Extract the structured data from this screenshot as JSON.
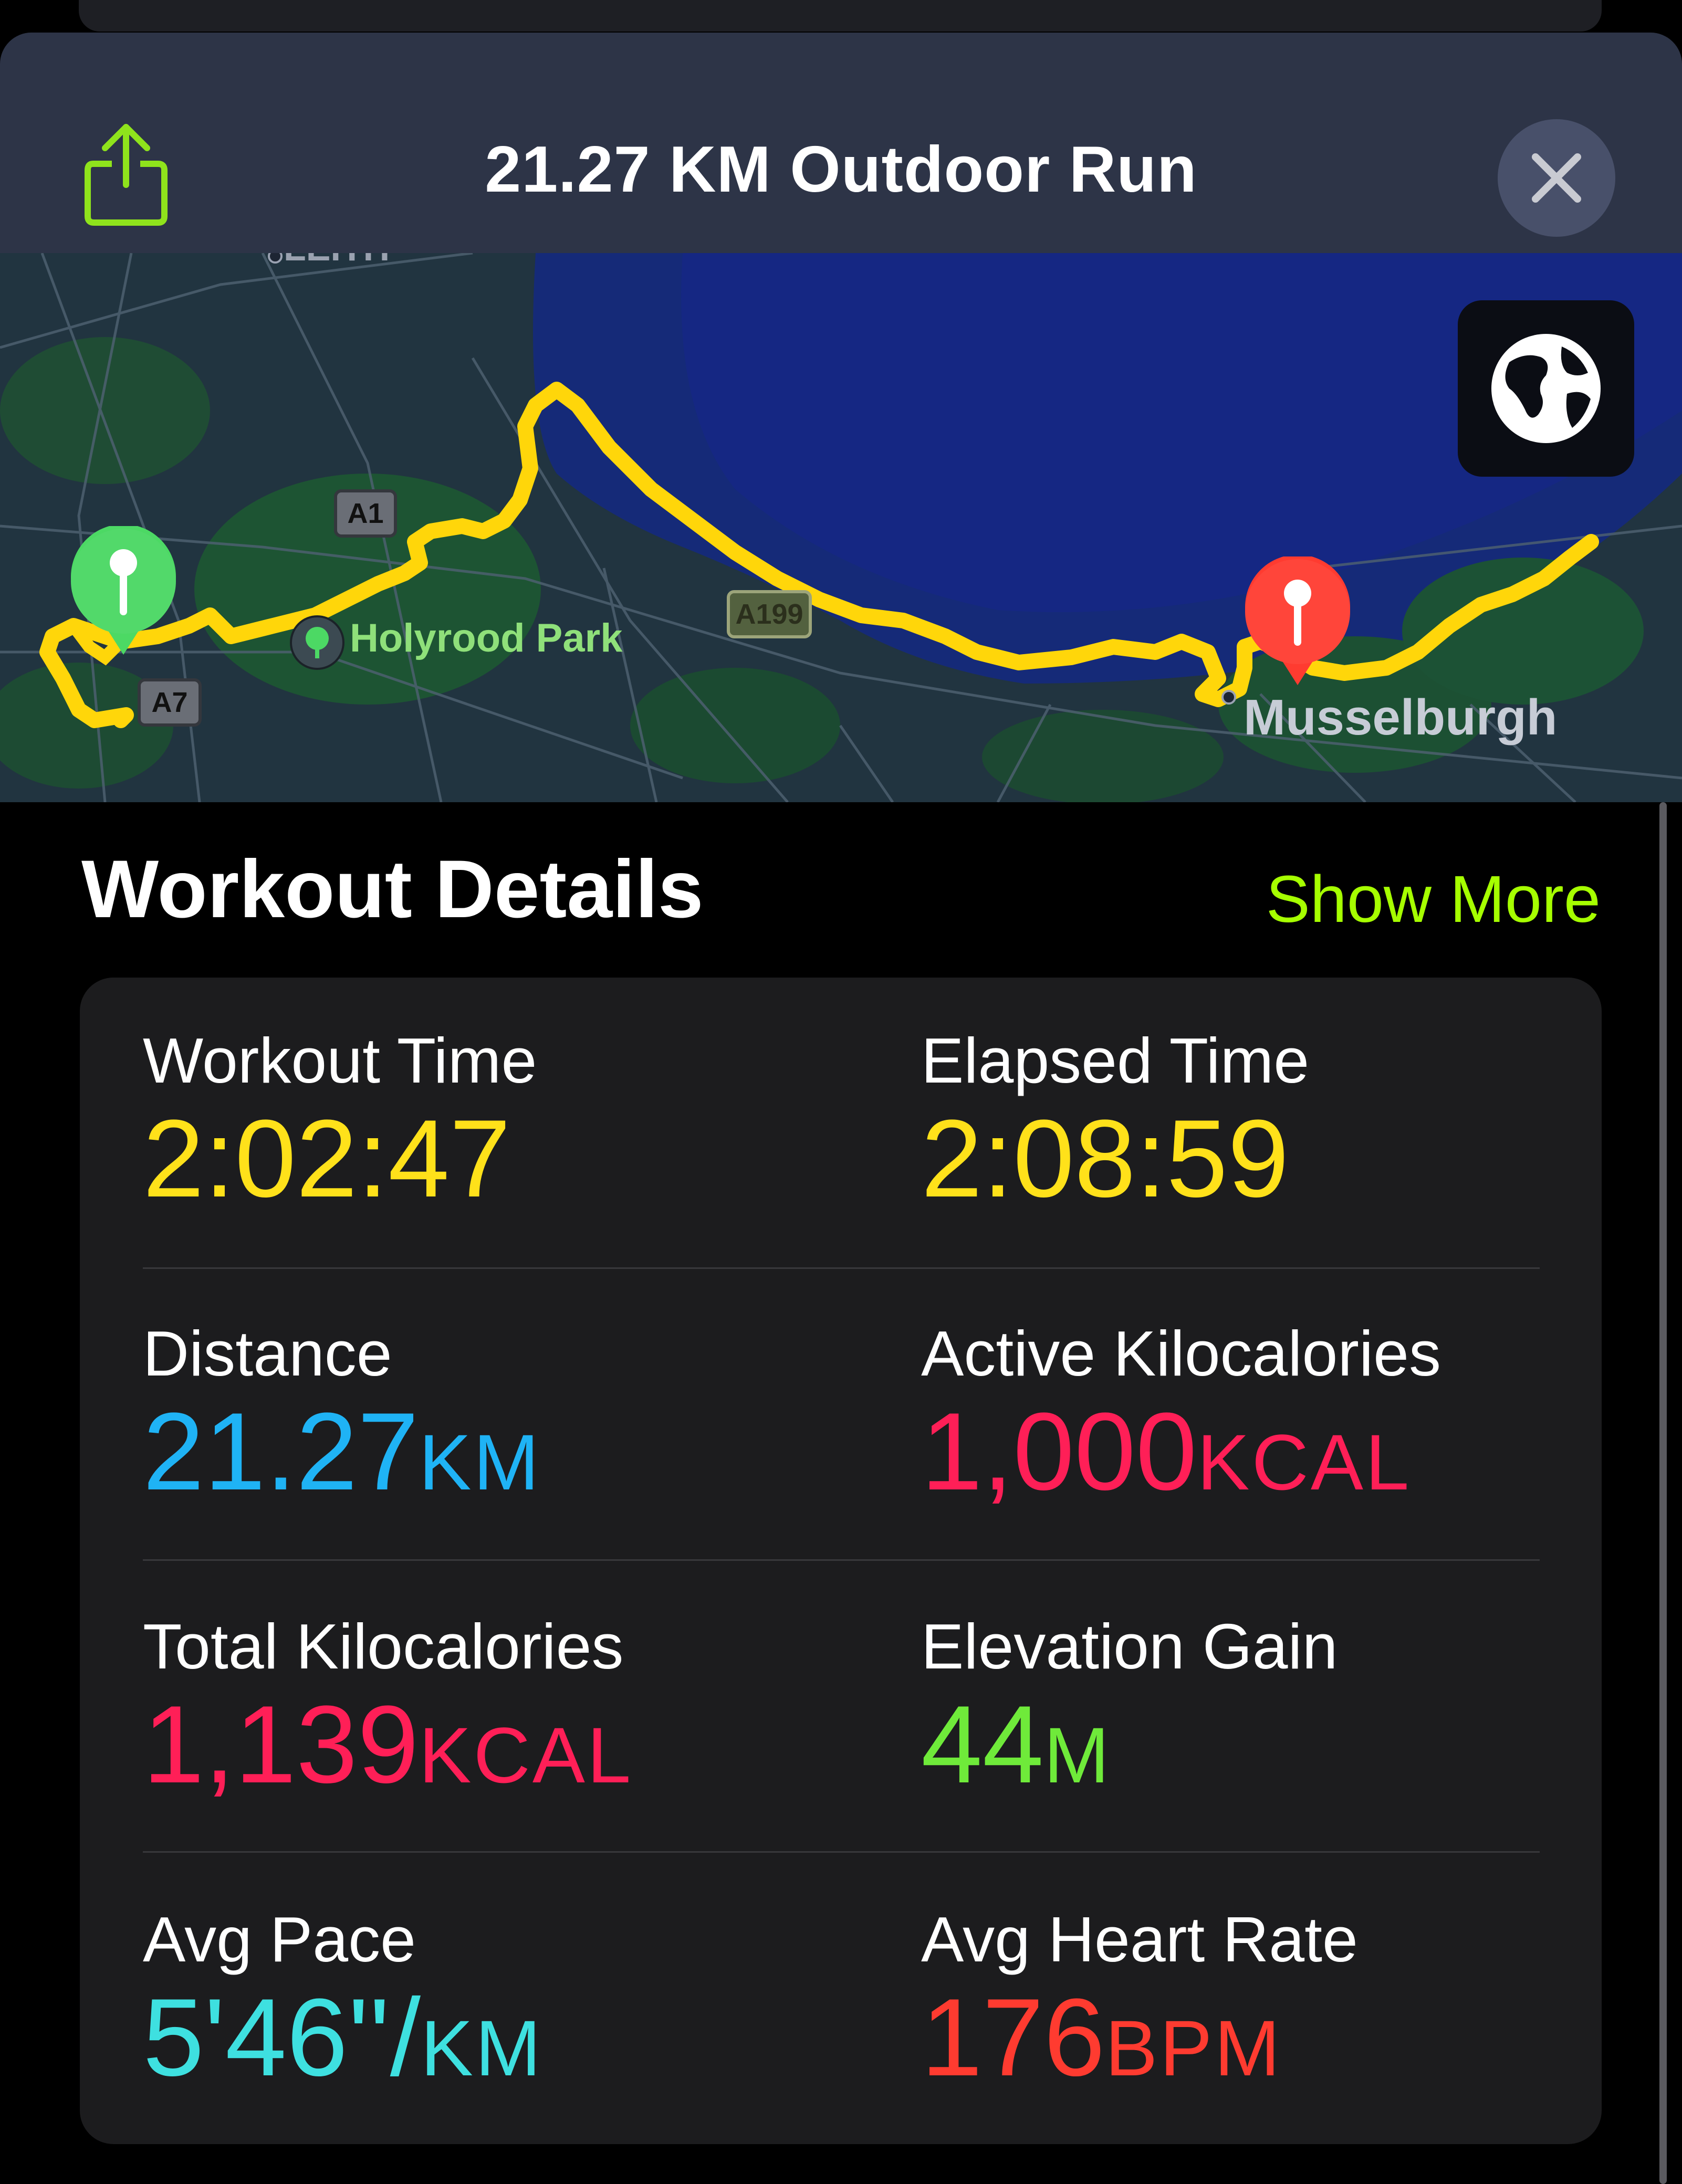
{
  "header": {
    "title": "21.27 KM Outdoor Run",
    "share_icon": "share-icon",
    "close_icon": "close-icon"
  },
  "map": {
    "labels": {
      "park": "Holyrood Park",
      "town": "Musselburgh",
      "top_label": "LEITH"
    },
    "roads": [
      "A1",
      "A199",
      "A7"
    ],
    "route_color": "#ffd60a",
    "start_pin_color": "#4cd964",
    "end_pin_color": "#ff3b30",
    "map_mode_icon": "globe-icon"
  },
  "details": {
    "title": "Workout Details",
    "show_more": "Show More",
    "metrics": [
      {
        "label": "Workout Time",
        "value": "2:02:47",
        "unit": "",
        "color": "#ffe11a"
      },
      {
        "label": "Elapsed Time",
        "value": "2:08:59",
        "unit": "",
        "color": "#ffe11a"
      },
      {
        "label": "Distance",
        "value": "21.27",
        "unit": "KM",
        "color": "#1fb3f5"
      },
      {
        "label": "Active Kilocalories",
        "value": "1,000",
        "unit": "KCAL",
        "color": "#ff1f57"
      },
      {
        "label": "Total Kilocalories",
        "value": "1,139",
        "unit": "KCAL",
        "color": "#ff1f57"
      },
      {
        "label": "Elevation Gain",
        "value": "44",
        "unit": "M",
        "color": "#6fea3a"
      },
      {
        "label": "Avg Pace",
        "value": "5'46''/",
        "unit": "KM",
        "color": "#3ee0e0"
      },
      {
        "label": "Avg Heart Rate",
        "value": "176",
        "unit": "BPM",
        "color": "#ff3b30"
      }
    ]
  }
}
